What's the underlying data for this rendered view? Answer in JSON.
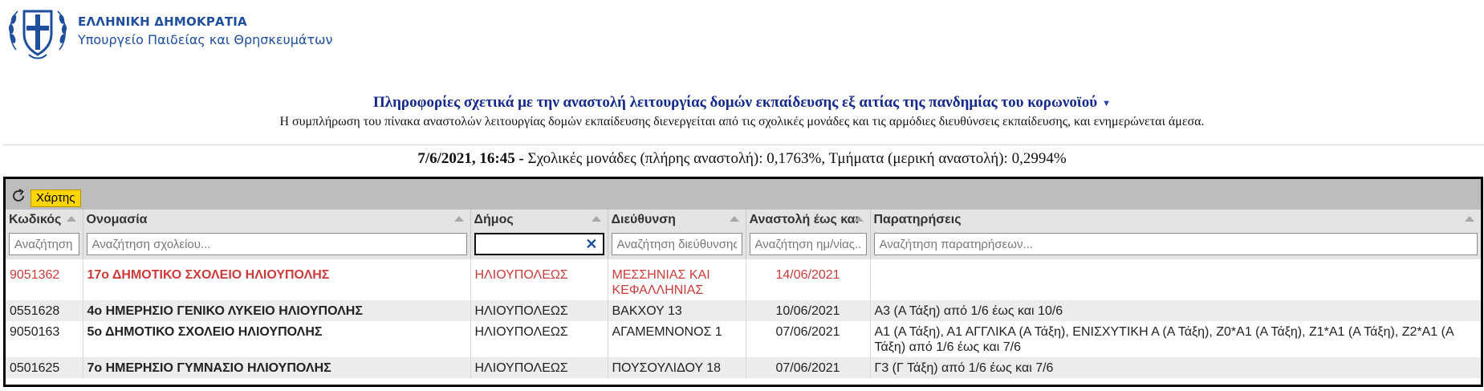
{
  "header": {
    "org_line1": "ΕΛΛΗΝΙΚΗ ΔΗΜΟΚΡΑΤΙΑ",
    "org_line2": "Υπουργείο Παιδείας και Θρησκευμάτων"
  },
  "info": {
    "title": "Πληροφορίες σχετικά με την αναστολή λειτουργίας δομών εκπαίδευσης εξ αιτίας της πανδημίας του κορωνοϊού",
    "subtitle": "Η συμπλήρωση του πίνακα αναστολών λειτουργίας δομών εκπαίδευσης διενεργείται από τις σχολικές μονάδες και τις αρμόδιες διευθύνσεις εκπαίδευσης, και ενημερώνεται άμεσα."
  },
  "stats": {
    "datetime": "7/6/2021, 16:45 -",
    "text": "Σχολικές μονάδες (πλήρης αναστολή): 0,1763%, Τμήματα (μερική αναστολή): 0,2994%"
  },
  "toolbar": {
    "map_label": "Χάρτης"
  },
  "columns": [
    {
      "label": "Κωδικός",
      "placeholder": "Αναζήτηση"
    },
    {
      "label": "Ονομασία",
      "placeholder": "Αναζήτηση σχολείου..."
    },
    {
      "label": "Δήμος",
      "placeholder": ""
    },
    {
      "label": "Διεύθυνση",
      "placeholder": "Αναζήτηση διεύθυνσης..."
    },
    {
      "label": "Αναστολή έως και",
      "placeholder": "Αναζήτηση ημ/νίας..."
    },
    {
      "label": "Παρατηρήσεις",
      "placeholder": "Αναζήτηση παρατηρήσεων..."
    }
  ],
  "colors": {
    "accent": "#1f4e9c",
    "highlight_row": "#cc3b3b",
    "map_button": "#ffd500"
  },
  "icons": {
    "refresh": "refresh-icon",
    "clear": "close-icon",
    "sort": "sort-up-icon"
  },
  "rows": [
    {
      "code": "9051362",
      "name": "17ο  ΔΗΜΟΤΙΚΟ ΣΧΟΛΕΙΟ ΗΛΙΟΥΠΟΛΗΣ",
      "dimos": "ΗΛΙΟΥΠΟΛΕΩΣ",
      "address": "ΜΕΣΣΗΝΙΑΣ ΚΑΙ ΚΕΦΑΛΛΗΝΙΑΣ",
      "date": "14/06/2021",
      "notes": ""
    },
    {
      "code": "0551628",
      "name": "4ο ΗΜΕΡΗΣΙΟ ΓΕΝΙΚΟ ΛΥΚΕΙΟ ΗΛΙΟΥΠΟΛΗΣ",
      "dimos": "ΗΛΙΟΥΠΟΛΕΩΣ",
      "address": "ΒΑΚΧΟΥ 13",
      "date": "10/06/2021",
      "notes": "Α3 (Α Τάξη) από 1/6 έως και 10/6"
    },
    {
      "code": "9050163",
      "name": "5ο ΔΗΜΟΤΙΚΟ ΣΧΟΛΕΙΟ ΗΛΙΟΥΠΟΛΗΣ",
      "dimos": "ΗΛΙΟΥΠΟΛΕΩΣ",
      "address": "ΑΓΑΜΕΜΝΟΝΟΣ 1",
      "date": "07/06/2021",
      "notes": "Α1 (Α Τάξη), Α1 ΑΓΓΛΙΚΑ (Α Τάξη), ΕΝΙΣΧΥΤΙΚΗ Α (Α Τάξη), Ζ0*Α1 (Α Τάξη), Ζ1*Α1 (Α Τάξη), Ζ2*Α1 (Α Τάξη) από 1/6 έως και 7/6"
    },
    {
      "code": "0501625",
      "name": "7ο ΗΜΕΡΗΣΙΟ ΓΥΜΝΑΣΙΟ ΗΛΙΟΥΠΟΛΗΣ",
      "dimos": "ΗΛΙΟΥΠΟΛΕΩΣ",
      "address": "ΠΟΥΣΟΥΛΙΔΟΥ 18",
      "date": "07/06/2021",
      "notes": "Γ3 (Γ Τάξη) από 1/6 έως και 7/6"
    }
  ]
}
